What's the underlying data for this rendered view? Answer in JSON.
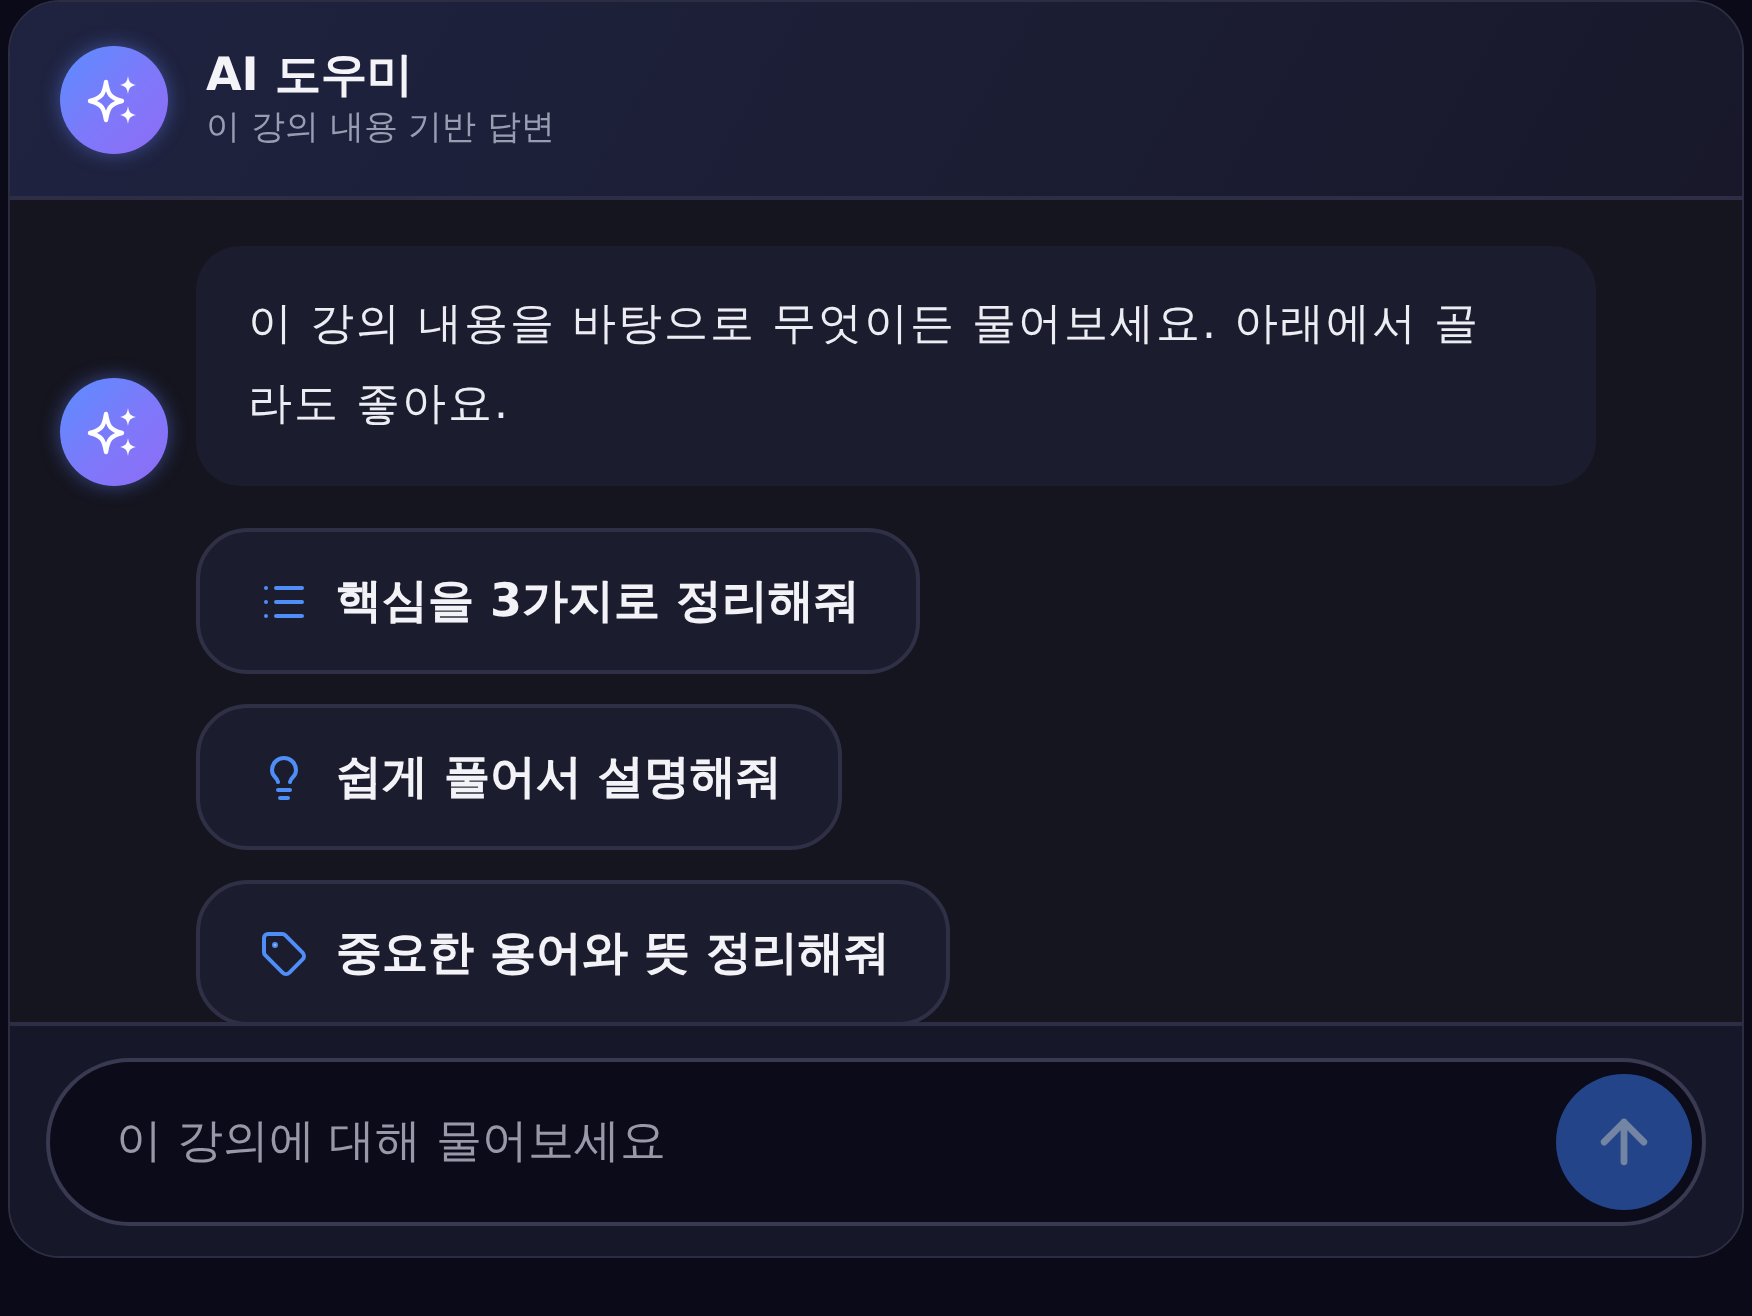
{
  "header": {
    "title": "AI 도우미",
    "subtitle": "이 강의 내용 기반 답변"
  },
  "messages": [
    {
      "kind": "bot",
      "text": "이 강의 내용을 바탕으로 무엇이든 물어보세요. 아래에서 골라도 좋아요."
    }
  ],
  "suggestions": [
    {
      "kind": "summary",
      "label": "핵심을 3가지로 정리해줘"
    },
    {
      "kind": "explain",
      "label": "쉽게 풀어서 설명해줘"
    },
    {
      "kind": "glossary",
      "label": "중요한 용어와 뜻 정리해줘"
    }
  ],
  "composer": {
    "placeholder": "이 강의에 대해 물어보세요",
    "send_disabled": true
  }
}
